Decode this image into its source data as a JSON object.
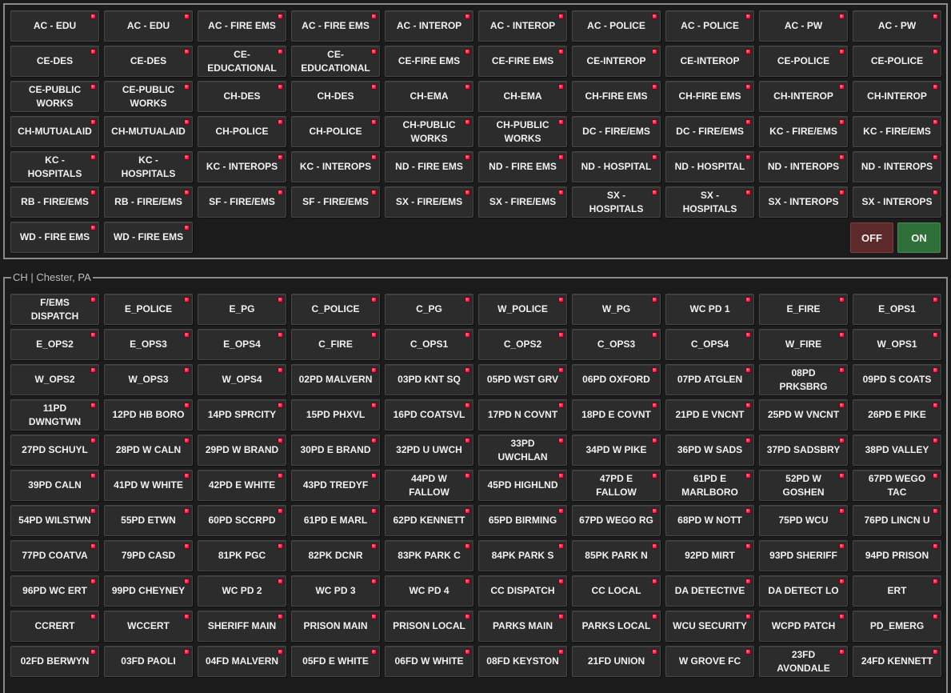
{
  "top": {
    "buttons": [
      "AC - EDU",
      "AC - EDU",
      "AC - FIRE EMS",
      "AC - FIRE EMS",
      "AC - INTEROP",
      "AC - INTEROP",
      "AC - POLICE",
      "AC - POLICE",
      "AC - PW",
      "AC - PW",
      "CE-DES",
      "CE-DES",
      "CE-EDUCATIONAL",
      "CE-EDUCATIONAL",
      "CE-FIRE EMS",
      "CE-FIRE EMS",
      "CE-INTEROP",
      "CE-INTEROP",
      "CE-POLICE",
      "CE-POLICE",
      "CE-PUBLIC WORKS",
      "CE-PUBLIC WORKS",
      "CH-DES",
      "CH-DES",
      "CH-EMA",
      "CH-EMA",
      "CH-FIRE EMS",
      "CH-FIRE EMS",
      "CH-INTEROP",
      "CH-INTEROP",
      "CH-MUTUALAID",
      "CH-MUTUALAID",
      "CH-POLICE",
      "CH-POLICE",
      "CH-PUBLIC WORKS",
      "CH-PUBLIC WORKS",
      "DC - FIRE/EMS",
      "DC - FIRE/EMS",
      "KC - FIRE/EMS",
      "KC - FIRE/EMS",
      "KC - HOSPITALS",
      "KC - HOSPITALS",
      "KC - INTEROPS",
      "KC - INTEROPS",
      "ND - FIRE EMS",
      "ND - FIRE EMS",
      "ND - HOSPITAL",
      "ND - HOSPITAL",
      "ND - INTEROPS",
      "ND - INTEROPS",
      "RB - FIRE/EMS",
      "RB - FIRE/EMS",
      "SF - FIRE/EMS",
      "SF - FIRE/EMS",
      "SX - FIRE/EMS",
      "SX - FIRE/EMS",
      "SX - HOSPITALS",
      "SX - HOSPITALS",
      "SX - INTEROPS",
      "SX - INTEROPS",
      "WD - FIRE EMS",
      "WD - FIRE EMS"
    ],
    "off_label": "OFF",
    "on_label": "ON"
  },
  "section": {
    "title": "CH | Chester, PA",
    "buttons": [
      "F/EMS DISPATCH",
      "E_POLICE",
      "E_PG",
      "C_POLICE",
      "C_PG",
      "W_POLICE",
      "W_PG",
      "WC PD 1",
      "E_FIRE",
      "E_OPS1",
      "E_OPS2",
      "E_OPS3",
      "E_OPS4",
      "C_FIRE",
      "C_OPS1",
      "C_OPS2",
      "C_OPS3",
      "C_OPS4",
      "W_FIRE",
      "W_OPS1",
      "W_OPS2",
      "W_OPS3",
      "W_OPS4",
      "02PD MALVERN",
      "03PD KNT SQ",
      "05PD WST GRV",
      "06PD OXFORD",
      "07PD ATGLEN",
      "08PD PRKSBRG",
      "09PD S COATS",
      "11PD DWNGTWN",
      "12PD HB BORO",
      "14PD SPRCITY",
      "15PD PHXVL",
      "16PD COATSVL",
      "17PD N COVNT",
      "18PD E COVNT",
      "21PD E VNCNT",
      "25PD W VNCNT",
      "26PD E PIKE",
      "27PD SCHUYL",
      "28PD W CALN",
      "29PD W BRAND",
      "30PD E BRAND",
      "32PD U UWCH",
      "33PD UWCHLAN",
      "34PD W PIKE",
      "36PD W SADS",
      "37PD SADSBRY",
      "38PD VALLEY",
      "39PD CALN",
      "41PD W WHITE",
      "42PD E WHITE",
      "43PD TREDYF",
      "44PD W FALLOW",
      "45PD HIGHLND",
      "47PD E FALLOW",
      "61PD E MARLBORO",
      "52PD W GOSHEN",
      "67PD WEGO TAC",
      "54PD WILSTWN",
      "55PD ETWN",
      "60PD SCCRPD",
      "61PD E MARL",
      "62PD KENNETT",
      "65PD BIRMING",
      "67PD WEGO RG",
      "68PD W NOTT",
      "75PD WCU",
      "76PD LINCN U",
      "77PD COATVA",
      "79PD CASD",
      "81PK PGC",
      "82PK DCNR",
      "83PK PARK C",
      "84PK PARK S",
      "85PK PARK N",
      "92PD MIRT",
      "93PD SHERIFF",
      "94PD PRISON",
      "96PD WC ERT",
      "99PD CHEYNEY",
      "WC PD 2",
      "WC PD 3",
      "WC PD 4",
      "CC DISPATCH",
      "CC LOCAL",
      "DA DETECTIVE",
      "DA DETECT LO",
      "ERT",
      "CCRERT",
      "WCCERT",
      "SHERIFF MAIN",
      "PRISON MAIN",
      "PRISON LOCAL",
      "PARKS MAIN",
      "PARKS LOCAL",
      "WCU SECURITY",
      "WCPD PATCH",
      "PD_EMERG",
      "02FD BERWYN",
      "03FD PAOLI",
      "04FD MALVERN",
      "05FD E WHITE",
      "06FD W WHITE",
      "08FD KEYSTON",
      "21FD UNION",
      "W GROVE FC",
      "23FD AVONDALE",
      "24FD KENNETT"
    ]
  },
  "colors": {
    "led": "#ff2b4a",
    "off": "#5c2a2a",
    "on": "#2f6f3a"
  }
}
